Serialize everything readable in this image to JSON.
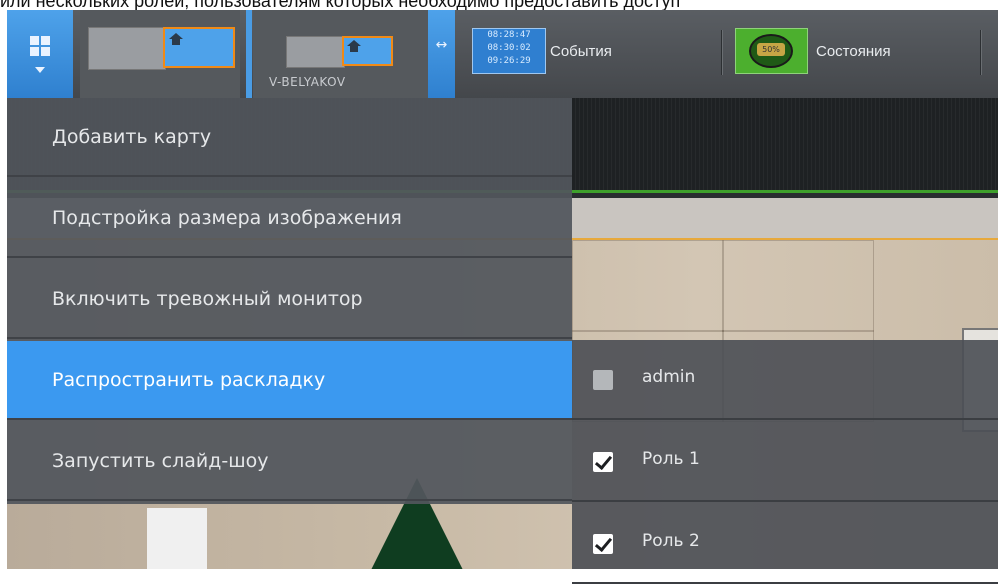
{
  "caption": "или нескольких ролей, пользователям которых необходимо предоставить доступ",
  "toolbar": {
    "workspace_name": "V-BELYAKOV",
    "events_times": [
      "08:28:47",
      "08:30:02",
      "09:26:29"
    ],
    "events_label": "События",
    "states_percent": "50%",
    "states_label": "Состояния"
  },
  "menu": {
    "items": [
      {
        "label": "Добавить карту"
      },
      {
        "label": "Подстройка размера изображения"
      },
      {
        "label": "Включить тревожный монитор"
      },
      {
        "label": "Распространить раскладку"
      },
      {
        "label": "Запустить слайд-шоу"
      }
    ],
    "active_index": 3
  },
  "roles": [
    {
      "label": "admin",
      "checked": false
    },
    {
      "label": "Роль 1",
      "checked": true
    },
    {
      "label": "Роль 2",
      "checked": true
    }
  ],
  "colors": {
    "accent": "#3b99f0",
    "toolbar_button": "#4ea2ea",
    "thumb_border": "#f08a16",
    "states_green": "#4caf2e"
  }
}
